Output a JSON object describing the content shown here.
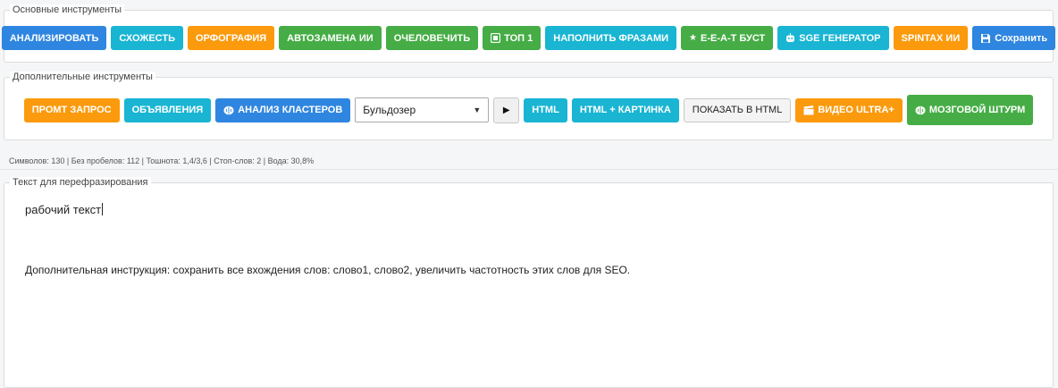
{
  "basic": {
    "legend": "Основные инструменты",
    "buttons": {
      "analyze": "АНАЛИЗИРОВАТЬ",
      "similarity": "СХОЖЕСТЬ",
      "spelling": "ОРФОГРАФИЯ",
      "autoreplace": "АВТОЗАМЕНА ИИ",
      "humanize": "ОЧЕЛОВЕЧИТЬ",
      "top1": "ТОП 1",
      "fill_phrases": "НАПОЛНИТЬ ФРАЗАМИ",
      "eeat": "E-E-A-T БУСТ",
      "sge": "SGE ГЕНЕРАТОР",
      "spintax": "SPINTAX ИИ",
      "save": "Сохранить"
    }
  },
  "extra": {
    "legend": "Дополнительные инструменты",
    "buttons": {
      "prompt": "ПРОМТ ЗАПРОС",
      "ads": "ОБЪЯВЛЕНИЯ",
      "clusters": "АНАЛИЗ КЛАСТЕРОВ",
      "html": "HTML",
      "html_image": "HTML + КАРТИНКА",
      "show_html": "ПОКАЗАТЬ В HTML",
      "video": "ВИДЕО ULTRA+",
      "brainstorm": "МОЗГОВОЙ ШТУРМ"
    },
    "select_value": "Бульдозер"
  },
  "stats": "Символов: 130 | Без пробелов: 112 | Тошнота: 1,4/3,6 | Стоп-слов: 2 | Вода: 30,8%",
  "editor": {
    "legend": "Текст для перефразирования",
    "line1": "рабочий текст",
    "line2": "Дополнительная инструкция: сохранить все вхождения слов: слово1, слово2, увеличить частотность этих слов для SEO."
  },
  "colors": {
    "blue": "#2f86e0",
    "cyan": "#19b5d3",
    "orange": "#fb9a0c",
    "green": "#46ad46"
  }
}
